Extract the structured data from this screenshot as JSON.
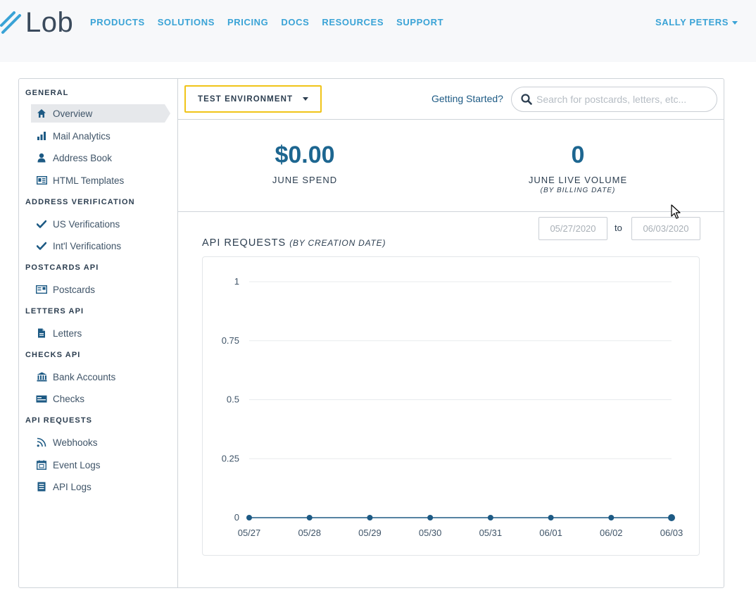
{
  "brand": {
    "name": "Lob"
  },
  "nav": {
    "items": [
      "PRODUCTS",
      "SOLUTIONS",
      "PRICING",
      "DOCS",
      "RESOURCES",
      "SUPPORT"
    ],
    "user": "SALLY PETERS"
  },
  "sidebar": {
    "sections": [
      {
        "title": "GENERAL",
        "items": [
          {
            "label": "Overview",
            "icon": "home-icon",
            "active": true
          },
          {
            "label": "Mail Analytics",
            "icon": "bar-chart-icon"
          },
          {
            "label": "Address Book",
            "icon": "user-icon"
          },
          {
            "label": "HTML Templates",
            "icon": "template-icon"
          }
        ]
      },
      {
        "title": "ADDRESS VERIFICATION",
        "items": [
          {
            "label": "US Verifications",
            "icon": "check-icon"
          },
          {
            "label": "Int'l Verifications",
            "icon": "check-icon"
          }
        ]
      },
      {
        "title": "POSTCARDS API",
        "items": [
          {
            "label": "Postcards",
            "icon": "postcard-icon"
          }
        ]
      },
      {
        "title": "LETTERS API",
        "items": [
          {
            "label": "Letters",
            "icon": "document-icon"
          }
        ]
      },
      {
        "title": "CHECKS API",
        "items": [
          {
            "label": "Bank Accounts",
            "icon": "bank-icon"
          },
          {
            "label": "Checks",
            "icon": "check-card-icon"
          }
        ]
      },
      {
        "title": "API REQUESTS",
        "items": [
          {
            "label": "Webhooks",
            "icon": "rss-icon"
          },
          {
            "label": "Event Logs",
            "icon": "calendar-icon"
          },
          {
            "label": "API Logs",
            "icon": "list-icon"
          }
        ]
      }
    ]
  },
  "header": {
    "environment": "TEST ENVIRONMENT",
    "getting_started": "Getting Started?",
    "search_placeholder": "Search for postcards, letters, etc..."
  },
  "stats": {
    "spend": {
      "value": "$0.00",
      "label": "JUNE SPEND"
    },
    "volume": {
      "value": "0",
      "label": "JUNE LIVE VOLUME",
      "sub": "(BY BILLING DATE)"
    }
  },
  "date_range": {
    "from": "05/27/2020",
    "to_label": "to",
    "to": "06/03/2020"
  },
  "chart_title": {
    "main": "API REQUESTS",
    "sub": "(BY CREATION DATE)"
  },
  "colors": {
    "accent": "#3aa3d6",
    "dark_blue": "#1d6690",
    "env_border": "#f0c419",
    "series": "#1d5a84"
  },
  "chart_data": {
    "type": "line",
    "title": "API REQUESTS (BY CREATION DATE)",
    "xlabel": "",
    "ylabel": "",
    "categories": [
      "05/27",
      "05/28",
      "05/29",
      "05/30",
      "05/31",
      "06/01",
      "06/02",
      "06/03"
    ],
    "series": [
      {
        "values": [
          0,
          0,
          0,
          0,
          0,
          0,
          0,
          0
        ]
      }
    ],
    "ylim": [
      0,
      1
    ],
    "yticks": [
      "0",
      "0.25",
      "0.5",
      "0.75",
      "1"
    ],
    "grid": true
  }
}
